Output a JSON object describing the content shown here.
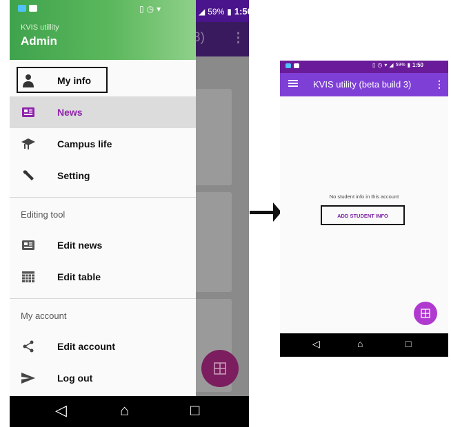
{
  "status_bar": {
    "battery": "59%",
    "time": "1:50"
  },
  "drawer": {
    "app_name": "KVIS utillity",
    "user": "Admin",
    "main_items": [
      {
        "label": "My info",
        "icon": "person-icon"
      },
      {
        "label": "News",
        "icon": "news-icon",
        "active": true
      },
      {
        "label": "Campus life",
        "icon": "campus-icon"
      },
      {
        "label": "Setting",
        "icon": "wrench-icon"
      }
    ],
    "editing_section": "Editing tool",
    "editing_items": [
      {
        "label": "Edit news",
        "icon": "edit-news-icon"
      },
      {
        "label": "Edit table",
        "icon": "table-icon"
      }
    ],
    "account_section": "My account",
    "account_items": [
      {
        "label": "Edit account",
        "icon": "share-icon"
      },
      {
        "label": "Log out",
        "icon": "send-icon"
      }
    ]
  },
  "left_appbar_ghost": "3)",
  "right_screen": {
    "title": "KVIS utility (beta build 3)",
    "empty_message": "No student info in this account",
    "add_button": "ADD STUDENT INFO"
  },
  "colors": {
    "primary": "#7e3fd6",
    "accent": "#b039d0",
    "drawer_header": "#5cb85c",
    "active_text": "#8e24aa"
  }
}
